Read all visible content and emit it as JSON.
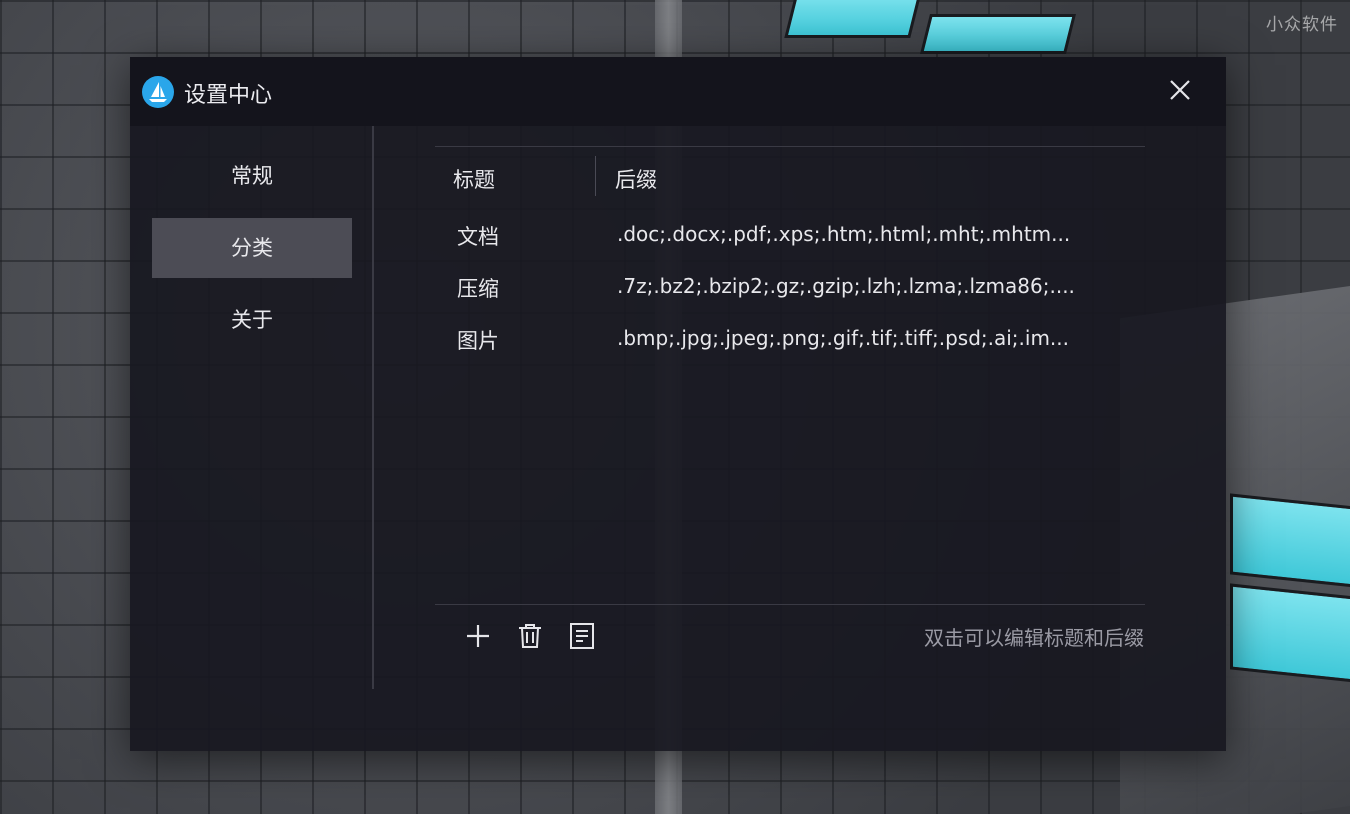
{
  "watermark": "小众软件",
  "dialog": {
    "title": "设置中心",
    "logo_icon": "sailboat-logo-icon",
    "close_icon": "close-icon"
  },
  "sidebar": {
    "items": [
      {
        "label": "常规",
        "active": false
      },
      {
        "label": "分类",
        "active": true
      },
      {
        "label": "关于",
        "active": false
      }
    ]
  },
  "table": {
    "headers": {
      "title": "标题",
      "suffix": "后缀"
    },
    "rows": [
      {
        "title": "文档",
        "suffix": ".doc;.docx;.pdf;.xps;.htm;.html;.mht;.mhtm..."
      },
      {
        "title": "压缩",
        "suffix": ".7z;.bz2;.bzip2;.gz;.gzip;.lzh;.lzma;.lzma86;...."
      },
      {
        "title": "图片",
        "suffix": ".bmp;.jpg;.jpeg;.png;.gif;.tif;.tiff;.psd;.ai;.im..."
      }
    ]
  },
  "toolbar": {
    "add_icon": "plus-icon",
    "delete_icon": "trash-icon",
    "edit_icon": "list-edit-icon",
    "hint": "双击可以编辑标题和后缀"
  },
  "colors": {
    "accent": "#2aa6ea",
    "dialog_bg": "#181820",
    "active_item_bg": "#4c4c55"
  }
}
